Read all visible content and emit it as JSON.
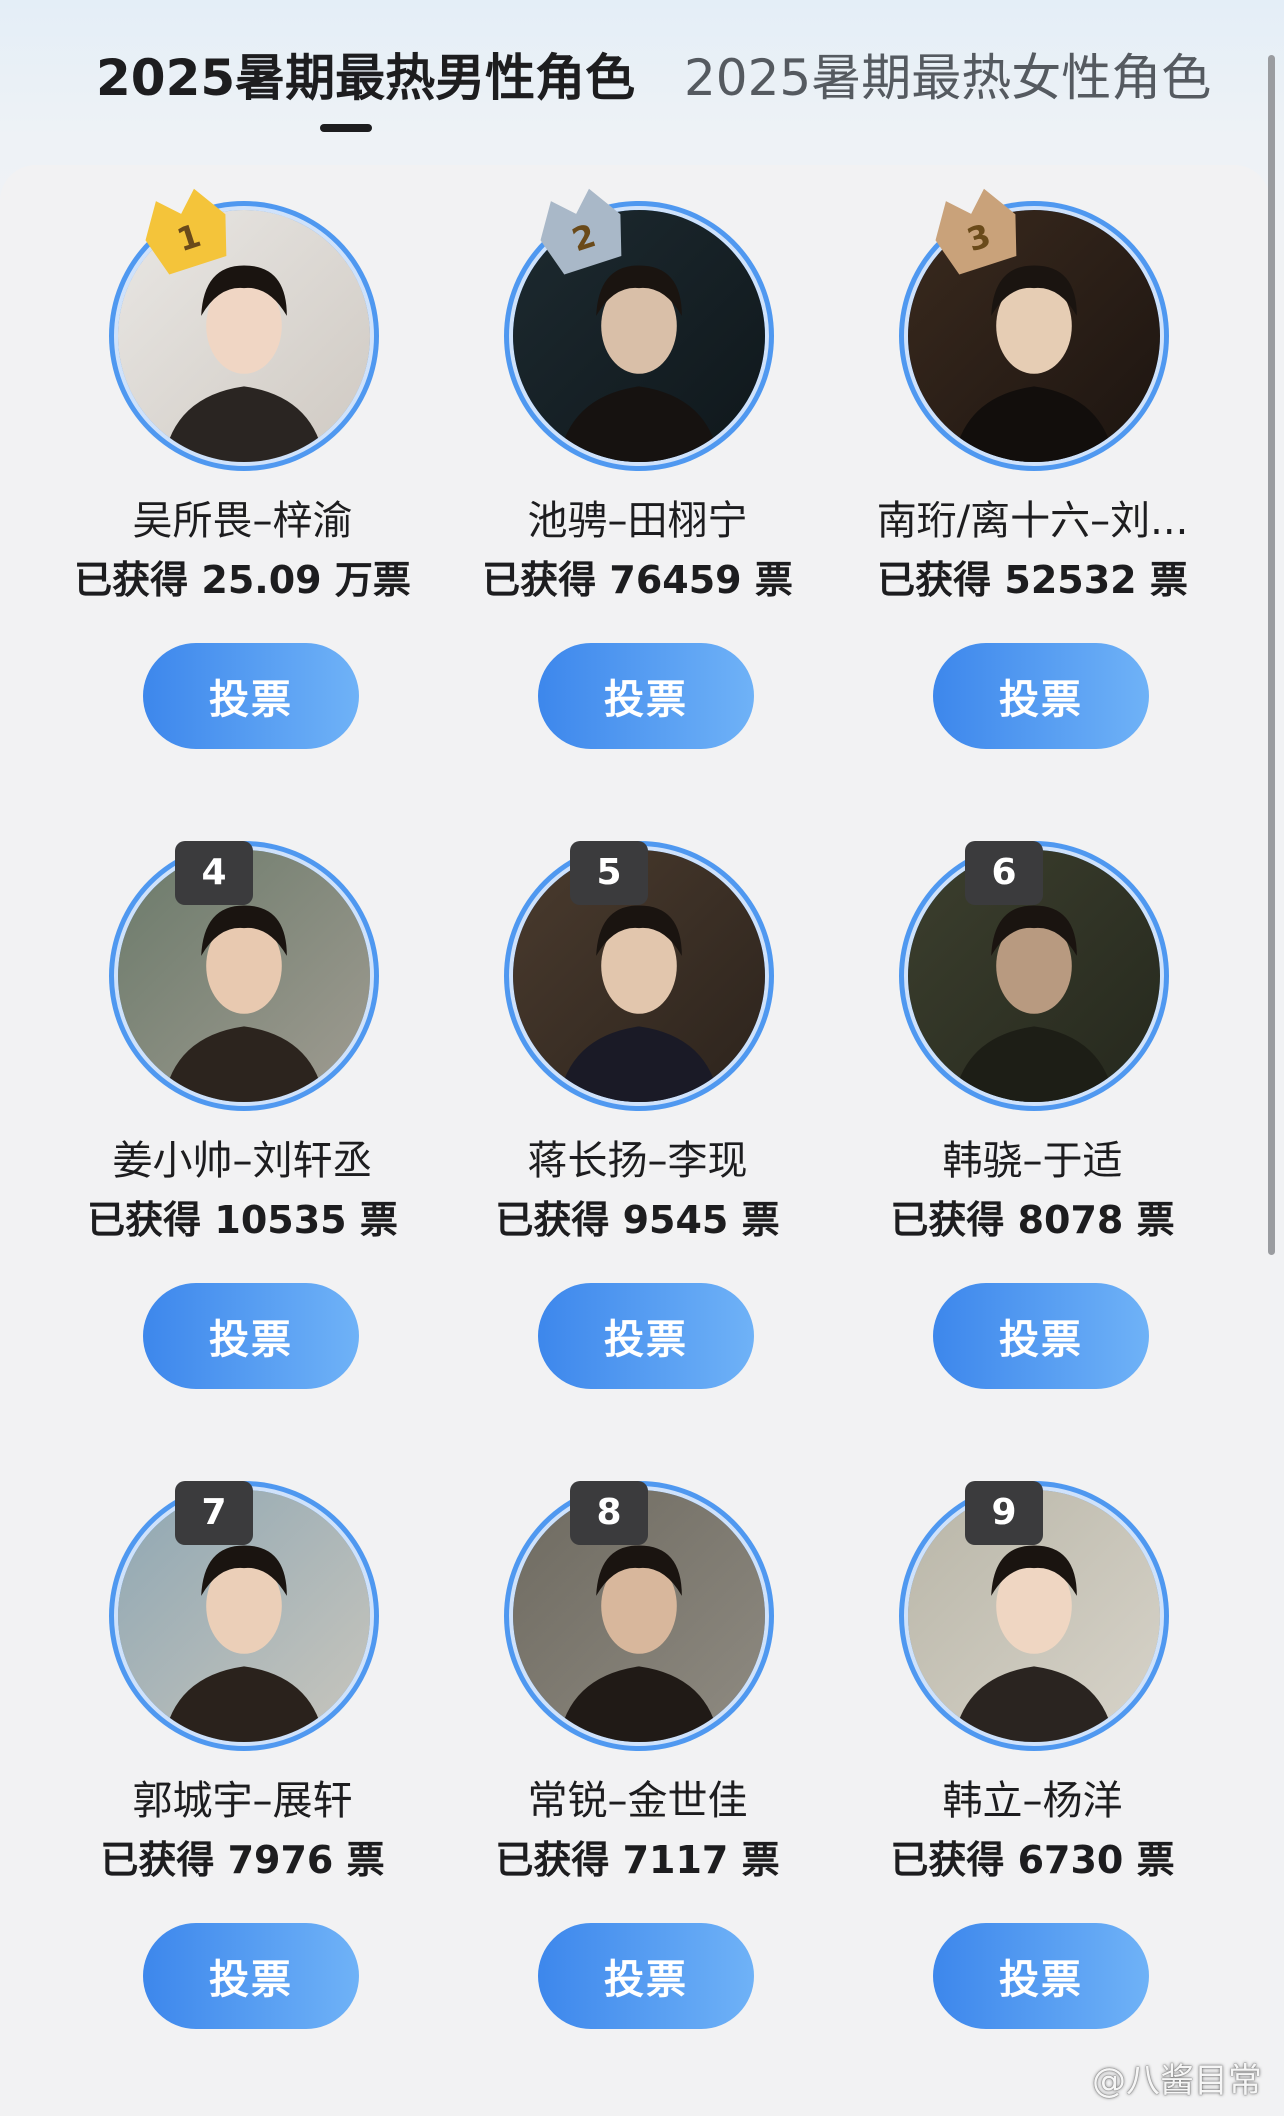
{
  "tabs": {
    "active": "2025暑期最热男性角色",
    "inactive": "2025暑期最热女性角色"
  },
  "colors": {
    "accent": "#4f98f0",
    "button_start": "#3d87ec",
    "button_end": "#6fb2f7",
    "rank_gold": "#f4c43a",
    "rank_silver": "#a9b8c8",
    "rank_bronze": "#c9a27a",
    "rank_dark": "#3b3b3d"
  },
  "characters": [
    {
      "rank": "1",
      "name": "吴所畏–梓渝",
      "votes": "已获得 25.09 万票",
      "button": "投票",
      "badge": "gold-crown-icon"
    },
    {
      "rank": "2",
      "name": "池骋–田栩宁",
      "votes": "已获得 76459 票",
      "button": "投票",
      "badge": "silver-crown-icon"
    },
    {
      "rank": "3",
      "name": "南珩/离十六–刘...",
      "votes": "已获得 52532 票",
      "button": "投票",
      "badge": "bronze-crown-icon"
    },
    {
      "rank": "4",
      "name": "姜小帅–刘轩丞",
      "votes": "已获得 10535 票",
      "button": "投票",
      "badge": "rank-box"
    },
    {
      "rank": "5",
      "name": "蒋长扬–李现",
      "votes": "已获得 9545 票",
      "button": "投票",
      "badge": "rank-box"
    },
    {
      "rank": "6",
      "name": "韩骁–于适",
      "votes": "已获得 8078 票",
      "button": "投票",
      "badge": "rank-box"
    },
    {
      "rank": "7",
      "name": "郭城宇–展轩",
      "votes": "已获得 7976 票",
      "button": "投票",
      "badge": "rank-box"
    },
    {
      "rank": "8",
      "name": "常锐–金世佳",
      "votes": "已获得 7117 票",
      "button": "投票",
      "badge": "rank-box"
    },
    {
      "rank": "9",
      "name": "韩立–杨洋",
      "votes": "已获得 6730 票",
      "button": "投票",
      "badge": "rank-box"
    }
  ],
  "watermark": "@八酱目常"
}
